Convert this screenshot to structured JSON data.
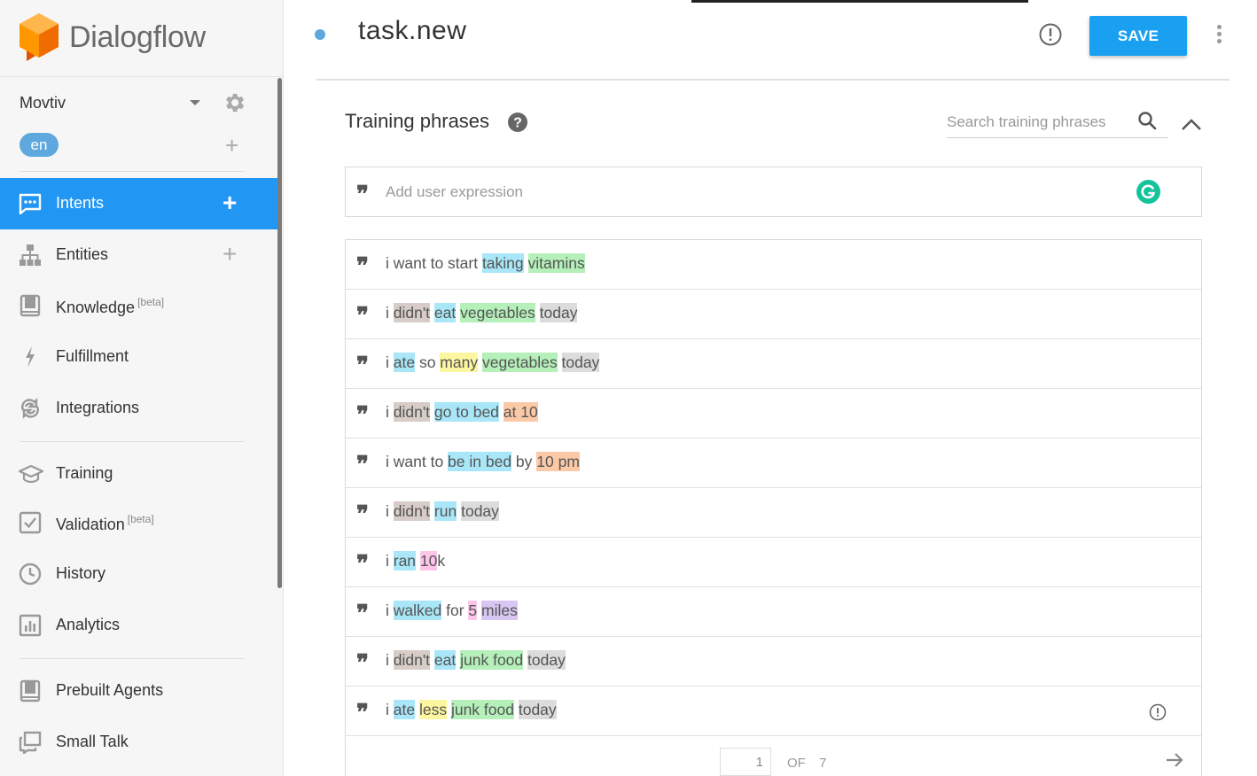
{
  "app": {
    "name": "Dialogflow"
  },
  "agent": {
    "name": "Movtiv",
    "language": "en"
  },
  "sidebar": {
    "items": [
      {
        "id": "intents",
        "label": "Intents",
        "beta": "",
        "has_plus": true,
        "active": true,
        "icon": "chat-icon"
      },
      {
        "id": "entities",
        "label": "Entities",
        "beta": "",
        "has_plus": true,
        "active": false,
        "icon": "sitemap-icon"
      },
      {
        "id": "knowledge",
        "label": "Knowledge",
        "beta": "[beta]",
        "has_plus": false,
        "active": false,
        "icon": "book-icon"
      },
      {
        "id": "fulfillment",
        "label": "Fulfillment",
        "beta": "",
        "has_plus": false,
        "active": false,
        "icon": "bolt-icon"
      },
      {
        "id": "integrations",
        "label": "Integrations",
        "beta": "",
        "has_plus": false,
        "active": false,
        "icon": "sync-icon"
      },
      {
        "id": "training",
        "label": "Training",
        "beta": "",
        "has_plus": false,
        "active": false,
        "icon": "graduation-cap-icon"
      },
      {
        "id": "validation",
        "label": "Validation",
        "beta": "[beta]",
        "has_plus": false,
        "active": false,
        "icon": "checkbox-icon"
      },
      {
        "id": "history",
        "label": "History",
        "beta": "",
        "has_plus": false,
        "active": false,
        "icon": "clock-icon"
      },
      {
        "id": "analytics",
        "label": "Analytics",
        "beta": "",
        "has_plus": false,
        "active": false,
        "icon": "bar-chart-icon"
      },
      {
        "id": "prebuilt",
        "label": "Prebuilt Agents",
        "beta": "",
        "has_plus": false,
        "active": false,
        "icon": "book-icon"
      },
      {
        "id": "smalltalk",
        "label": "Small Talk",
        "beta": "",
        "has_plus": false,
        "active": false,
        "icon": "chat-bubbles-icon"
      }
    ]
  },
  "header": {
    "intent_name": "task.new",
    "save_label": "SAVE"
  },
  "training": {
    "title": "Training phrases",
    "search_placeholder": "Search training phrases",
    "add_placeholder": "Add user expression",
    "phrases": [
      {
        "segments": [
          {
            "t": "i want to start ",
            "c": ""
          },
          {
            "t": "taking",
            "c": "blue"
          },
          {
            "t": " ",
            "c": ""
          },
          {
            "t": "vitamins",
            "c": "green"
          }
        ],
        "warning": false
      },
      {
        "segments": [
          {
            "t": "i ",
            "c": ""
          },
          {
            "t": "didn't",
            "c": "brown"
          },
          {
            "t": " ",
            "c": ""
          },
          {
            "t": "eat",
            "c": "blue"
          },
          {
            "t": " ",
            "c": ""
          },
          {
            "t": "vegetables",
            "c": "green"
          },
          {
            "t": " ",
            "c": ""
          },
          {
            "t": "today",
            "c": "gray"
          }
        ],
        "warning": false
      },
      {
        "segments": [
          {
            "t": "i ",
            "c": ""
          },
          {
            "t": "ate",
            "c": "blue"
          },
          {
            "t": " so ",
            "c": ""
          },
          {
            "t": "many",
            "c": "yellow"
          },
          {
            "t": " ",
            "c": ""
          },
          {
            "t": "vegetables",
            "c": "green"
          },
          {
            "t": " ",
            "c": ""
          },
          {
            "t": "today",
            "c": "gray"
          }
        ],
        "warning": false
      },
      {
        "segments": [
          {
            "t": "i ",
            "c": ""
          },
          {
            "t": "didn't",
            "c": "brown"
          },
          {
            "t": " ",
            "c": ""
          },
          {
            "t": "go to bed",
            "c": "blue"
          },
          {
            "t": " ",
            "c": ""
          },
          {
            "t": "at 10",
            "c": "orange"
          }
        ],
        "warning": false
      },
      {
        "segments": [
          {
            "t": "i want to ",
            "c": ""
          },
          {
            "t": "be in bed",
            "c": "blue"
          },
          {
            "t": " by ",
            "c": ""
          },
          {
            "t": "10 pm",
            "c": "orange"
          }
        ],
        "warning": false
      },
      {
        "segments": [
          {
            "t": "i ",
            "c": ""
          },
          {
            "t": "didn't",
            "c": "brown"
          },
          {
            "t": " ",
            "c": ""
          },
          {
            "t": "run",
            "c": "blue"
          },
          {
            "t": " ",
            "c": ""
          },
          {
            "t": "today",
            "c": "gray"
          }
        ],
        "warning": false
      },
      {
        "segments": [
          {
            "t": "i ",
            "c": ""
          },
          {
            "t": "ran",
            "c": "blue"
          },
          {
            "t": " ",
            "c": ""
          },
          {
            "t": "10",
            "c": "pink"
          },
          {
            "t": "k",
            "c": ""
          }
        ],
        "warning": false
      },
      {
        "segments": [
          {
            "t": "i ",
            "c": ""
          },
          {
            "t": "walked",
            "c": "blue"
          },
          {
            "t": " for ",
            "c": ""
          },
          {
            "t": "5",
            "c": "pink"
          },
          {
            "t": " ",
            "c": ""
          },
          {
            "t": "miles",
            "c": "purple"
          }
        ],
        "warning": false
      },
      {
        "segments": [
          {
            "t": "i ",
            "c": ""
          },
          {
            "t": "didn't",
            "c": "brown"
          },
          {
            "t": " ",
            "c": ""
          },
          {
            "t": "eat",
            "c": "blue"
          },
          {
            "t": " ",
            "c": ""
          },
          {
            "t": "junk food",
            "c": "green"
          },
          {
            "t": " ",
            "c": ""
          },
          {
            "t": "today",
            "c": "gray"
          }
        ],
        "warning": false
      },
      {
        "segments": [
          {
            "t": "i ",
            "c": ""
          },
          {
            "t": "ate",
            "c": "blue"
          },
          {
            "t": " ",
            "c": ""
          },
          {
            "t": "less",
            "c": "yellow"
          },
          {
            "t": " ",
            "c": ""
          },
          {
            "t": "junk food",
            "c": "green"
          },
          {
            "t": " ",
            "c": ""
          },
          {
            "t": "today",
            "c": "gray"
          }
        ],
        "warning": true
      }
    ],
    "pagination": {
      "current": "1",
      "of_label": "OF",
      "total": "7"
    }
  },
  "colors": {
    "accent": "#2196f3",
    "save": "#1aa0f0",
    "logo": "#f57c00",
    "grammarly": "#15c39a"
  }
}
